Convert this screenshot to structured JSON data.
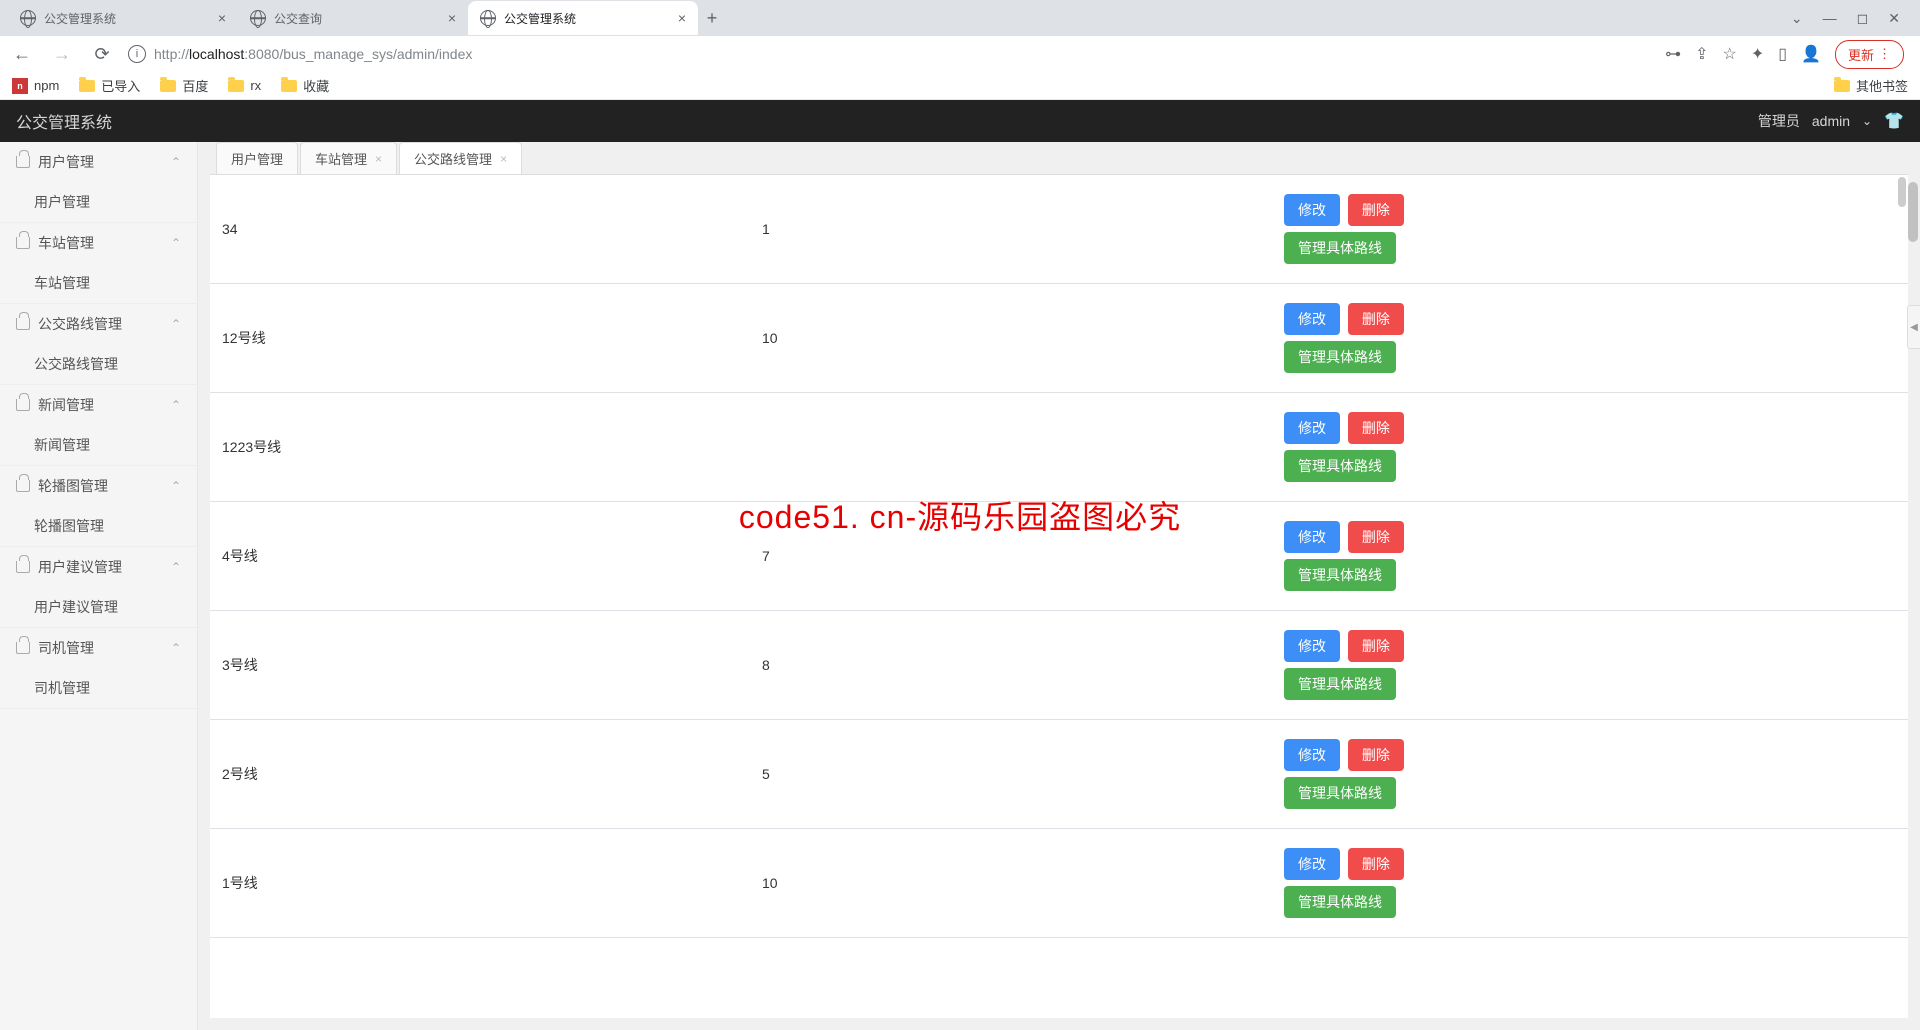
{
  "browser": {
    "tabs": [
      {
        "title": "公交管理系统"
      },
      {
        "title": "公交查询"
      },
      {
        "title": "公交管理系统"
      }
    ],
    "url_prefix": "http://",
    "url_host": "localhost",
    "url_port": ":8080",
    "url_path": "/bus_manage_sys/admin/index",
    "update_label": "更新",
    "bookmarks": [
      {
        "label": "npm",
        "icon": "npm"
      },
      {
        "label": "已导入",
        "icon": "folder"
      },
      {
        "label": "百度",
        "icon": "folder"
      },
      {
        "label": "rx",
        "icon": "folder"
      },
      {
        "label": "收藏",
        "icon": "folder"
      }
    ],
    "other_bookmarks": "其他书签"
  },
  "app": {
    "title": "公交管理系统",
    "role": "管理员",
    "username": "admin"
  },
  "sidebar": [
    {
      "header": "用户管理",
      "items": [
        "用户管理"
      ]
    },
    {
      "header": "车站管理",
      "items": [
        "车站管理"
      ]
    },
    {
      "header": "公交路线管理",
      "items": [
        "公交路线管理"
      ]
    },
    {
      "header": "新闻管理",
      "items": [
        "新闻管理"
      ]
    },
    {
      "header": "轮播图管理",
      "items": [
        "轮播图管理"
      ]
    },
    {
      "header": "用户建议管理",
      "items": [
        "用户建议管理"
      ]
    },
    {
      "header": "司机管理",
      "items": [
        "司机管理"
      ]
    }
  ],
  "content_tabs": [
    {
      "label": "用户管理",
      "closable": false,
      "active": false
    },
    {
      "label": "车站管理",
      "closable": true,
      "active": false
    },
    {
      "label": "公交路线管理",
      "closable": true,
      "active": true
    }
  ],
  "table": {
    "rows": [
      {
        "name": "34",
        "count": "1"
      },
      {
        "name": "12号线",
        "count": "10"
      },
      {
        "name": "1223号线",
        "count": ""
      },
      {
        "name": "4号线",
        "count": "7"
      },
      {
        "name": "3号线",
        "count": "8"
      },
      {
        "name": "2号线",
        "count": "5"
      },
      {
        "name": "1号线",
        "count": "10"
      }
    ],
    "btn_edit": "修改",
    "btn_delete": "删除",
    "btn_manage": "管理具体路线"
  },
  "watermark": "code51. cn-源码乐园盗图必究"
}
